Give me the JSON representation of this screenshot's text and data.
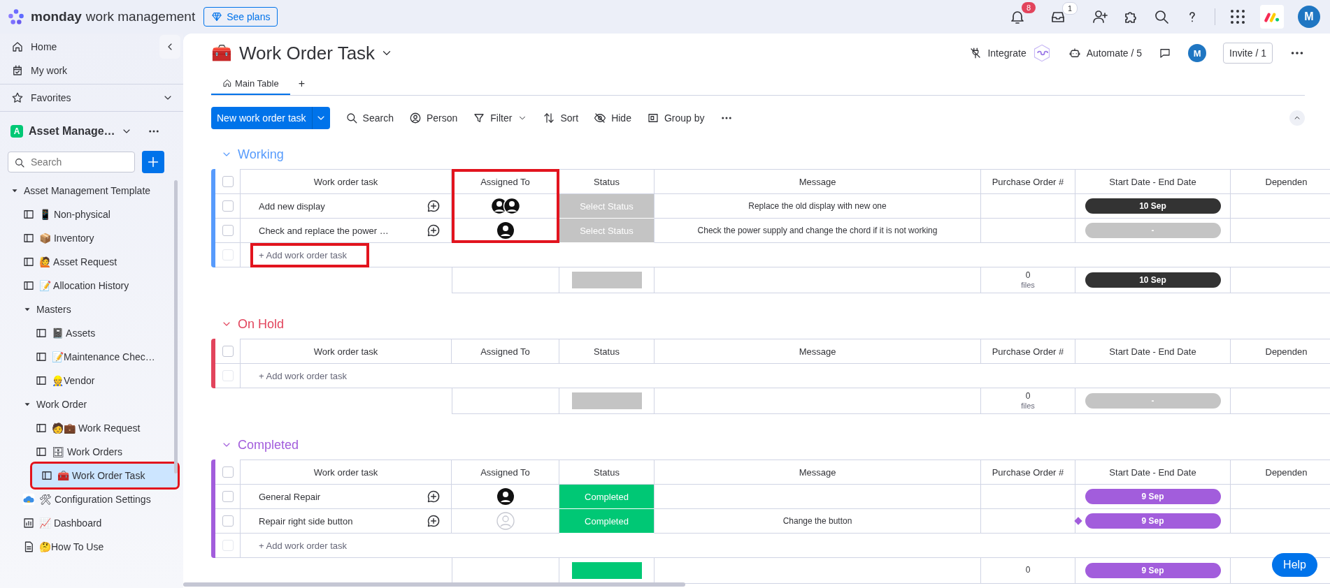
{
  "topbar": {
    "brand": "monday",
    "product": "work management",
    "plans_button": "See plans",
    "notifications_badge": "8",
    "inbox_badge": "1",
    "avatar": "M"
  },
  "sidebar": {
    "nav": [
      {
        "label": "Home",
        "kind": "home"
      },
      {
        "label": "My work",
        "kind": "mywork"
      }
    ],
    "favorites": "Favorites",
    "workspace": {
      "badge": "A",
      "name": "Asset Manage…"
    },
    "search": {
      "placeholder": "Search"
    },
    "tree": [
      {
        "label": "Asset Management Template",
        "kind": "folder",
        "expanded": true,
        "selected": false,
        "children": [
          {
            "label": "📱 Non-physical",
            "kind": "board",
            "selected": false
          },
          {
            "label": "📦 Inventory",
            "kind": "board",
            "selected": false
          },
          {
            "label": "🙋 Asset Request",
            "kind": "board",
            "selected": false
          },
          {
            "label": "📝 Allocation History",
            "kind": "board",
            "selected": false
          },
          {
            "label": "Masters",
            "kind": "folder",
            "expanded": true,
            "selected": false,
            "children": [
              {
                "label": "📓 Assets",
                "kind": "board",
                "selected": false
              },
              {
                "label": "📝Maintenance Chec…",
                "kind": "board",
                "selected": false
              },
              {
                "label": "👷Vendor",
                "kind": "board",
                "selected": false
              }
            ]
          },
          {
            "label": "Work Order",
            "kind": "folder",
            "expanded": true,
            "selected": false,
            "children": [
              {
                "label": "🧑💼 Work Request",
                "kind": "board",
                "selected": false
              },
              {
                "label": "🗄 Work Orders",
                "kind": "board",
                "selected": false
              },
              {
                "label": "🧰 Work Order Task",
                "kind": "board",
                "selected": true,
                "highlighted": true
              }
            ]
          },
          {
            "label": "🛠 Configuration Settings",
            "kind": "app",
            "selected": false
          },
          {
            "label": "📈 Dashboard",
            "kind": "dashboard",
            "selected": false
          },
          {
            "label": "🤔How To Use",
            "kind": "doc",
            "selected": false
          }
        ]
      }
    ]
  },
  "board": {
    "icon": "🧰",
    "title": "Work Order Task",
    "actions": [
      {
        "label": "Integrate",
        "kind": "integrate"
      },
      {
        "label": "Automate / 5",
        "kind": "automate"
      }
    ],
    "avatar": "M",
    "invite": "Invite / 1",
    "tabs": [
      {
        "label": "Main Table",
        "selected": true
      }
    ],
    "add_view": "+",
    "new_button": "New work order task",
    "tools": [
      {
        "label": "Search",
        "kind": "search"
      },
      {
        "label": "Person",
        "kind": "person"
      },
      {
        "label": "Filter",
        "kind": "filter"
      },
      {
        "label": "Sort",
        "kind": "sort"
      },
      {
        "label": "Hide",
        "kind": "hide"
      },
      {
        "label": "Group by",
        "kind": "group"
      }
    ]
  },
  "groups": [
    {
      "title": "Working",
      "color": "#579bfc",
      "all_checked": false,
      "columns": [
        {
          "label": "Work order task",
          "highlighted": false
        },
        {
          "label": "Assigned To",
          "highlighted": true
        },
        {
          "label": "Status",
          "highlighted": false
        },
        {
          "label": "Message",
          "highlighted": false
        },
        {
          "label": "Purchase Order #",
          "highlighted": false
        },
        {
          "label": "Start Date - End Date",
          "highlighted": false
        },
        {
          "label": "Dependen",
          "highlighted": false
        }
      ],
      "rows": [
        {
          "checked": false,
          "task": "Add new display",
          "assignee": {
            "kind": "double"
          },
          "status": {
            "label": "Select Status",
            "color": "#c4c4c4"
          },
          "message": "Replace the old display with new one",
          "date": {
            "label": "10 Sep",
            "color": "#333333"
          },
          "milestone": false
        },
        {
          "checked": false,
          "task": "Check and replace the power …",
          "assignee": {
            "kind": "single"
          },
          "status": {
            "label": "Select Status",
            "color": "#c4c4c4"
          },
          "message": "Check the power supply and change the chord if it is not working",
          "date": {
            "label": "-",
            "color": "#c4c4c4"
          },
          "milestone": false
        }
      ],
      "add_row": {
        "label": "+ Add work order task",
        "highlighted": true,
        "checkbox_disabled": true
      },
      "summary": {
        "status": {
          "color": "#c4c4c4"
        },
        "files_count": "0",
        "files_label": "files",
        "date": {
          "label": "10 Sep",
          "color": "#333333"
        }
      }
    },
    {
      "title": "On Hold",
      "color": "#e2445c",
      "all_checked": false,
      "columns": [
        {
          "label": "Work order task",
          "highlighted": false
        },
        {
          "label": "Assigned To",
          "highlighted": false
        },
        {
          "label": "Status",
          "highlighted": false
        },
        {
          "label": "Message",
          "highlighted": false
        },
        {
          "label": "Purchase Order #",
          "highlighted": false
        },
        {
          "label": "Start Date - End Date",
          "highlighted": false
        },
        {
          "label": "Dependen",
          "highlighted": false
        }
      ],
      "add_row": {
        "label": "+ Add work order task",
        "highlighted": false,
        "checkbox_disabled": true
      },
      "summary": {
        "status": {
          "color": "#c4c4c4"
        },
        "files_count": "0",
        "files_label": "files",
        "date": {
          "label": "-",
          "color": "#c4c4c4"
        }
      }
    },
    {
      "title": "Completed",
      "color": "#a25ddc",
      "all_checked": false,
      "columns": [
        {
          "label": "Work order task",
          "highlighted": false
        },
        {
          "label": "Assigned To",
          "highlighted": false
        },
        {
          "label": "Status",
          "highlighted": false
        },
        {
          "label": "Message",
          "highlighted": false
        },
        {
          "label": "Purchase Order #",
          "highlighted": false
        },
        {
          "label": "Start Date - End Date",
          "highlighted": false
        },
        {
          "label": "Dependen",
          "highlighted": false
        }
      ],
      "rows": [
        {
          "checked": false,
          "task": "General Repair",
          "assignee": {
            "kind": "single"
          },
          "status": {
            "label": "Completed",
            "color": "#00c875"
          },
          "date": {
            "label": "9 Sep",
            "color": "#a25ddc"
          },
          "milestone": false
        },
        {
          "checked": false,
          "task": "Repair right side button",
          "assignee": {
            "kind": "none"
          },
          "status": {
            "label": "Completed",
            "color": "#00c875"
          },
          "message": "Change the button",
          "date": {
            "label": "9 Sep",
            "color": "#a25ddc"
          },
          "milestone": true
        }
      ],
      "add_row": {
        "label": "+ Add work order task",
        "highlighted": false,
        "checkbox_disabled": true
      },
      "summary": {
        "status": {
          "color": "#00c875"
        },
        "files_count": "0",
        "date": {
          "label": "9 Sep",
          "color": "#a25ddc"
        }
      }
    }
  ],
  "help_button": "Help"
}
